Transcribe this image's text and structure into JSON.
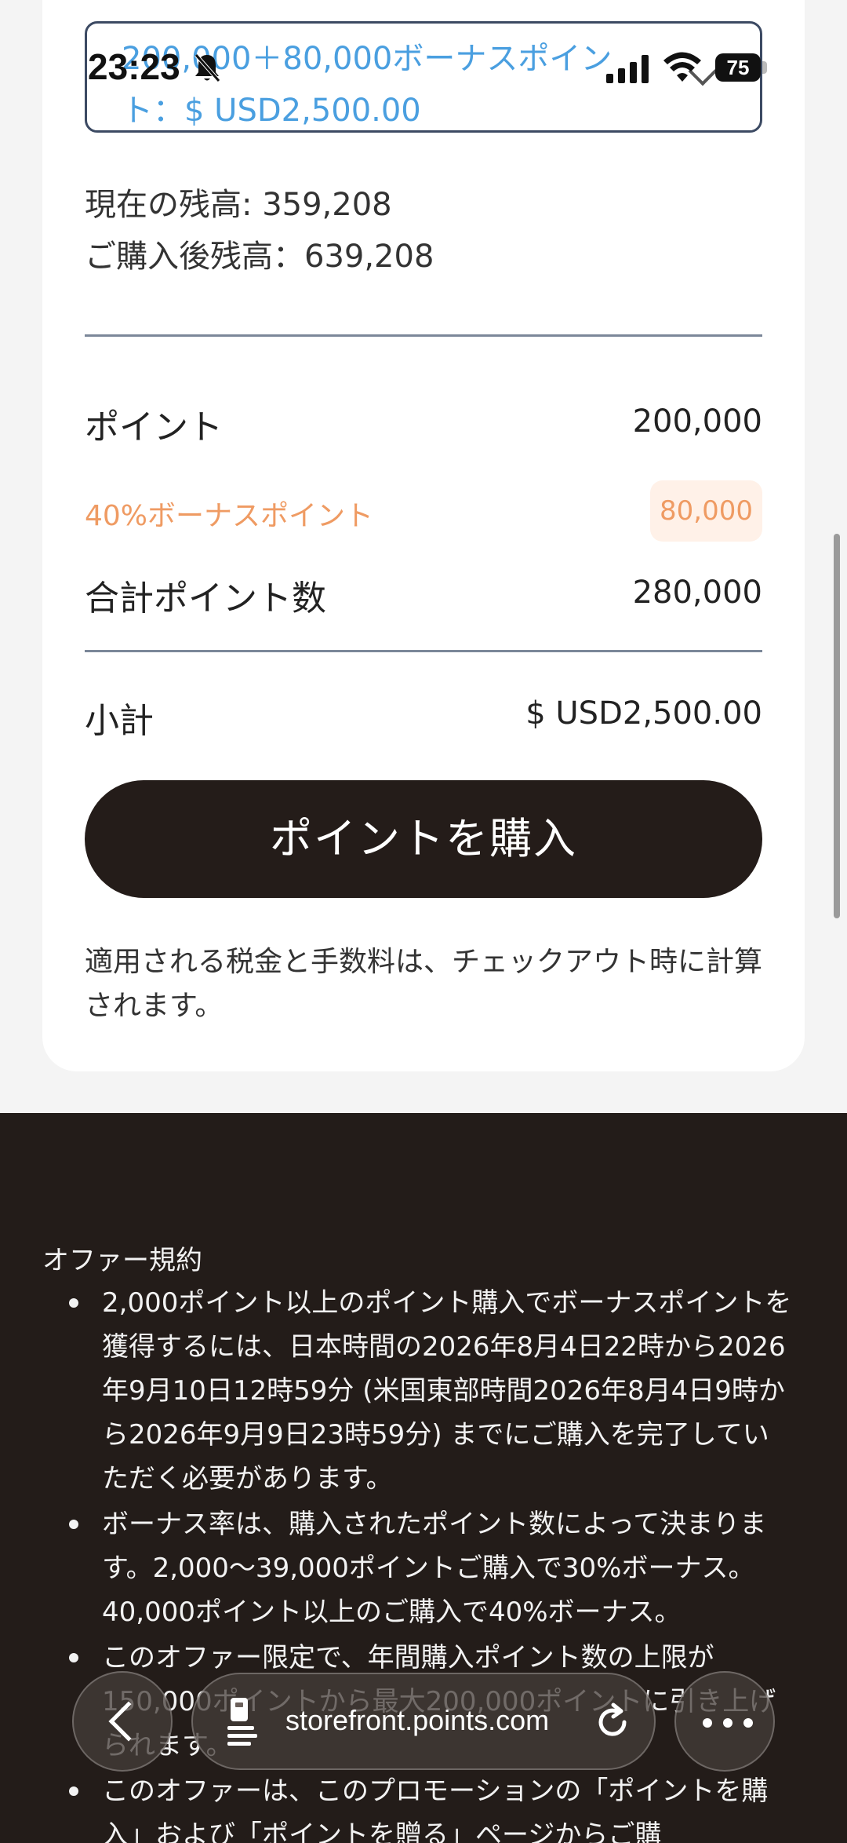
{
  "status": {
    "time": "23:23",
    "battery": "75"
  },
  "package_select": {
    "value_line1": "200,000＋80,000ボーナスポイン",
    "value_line2": "ト：$ USD2,500.00"
  },
  "balance": {
    "current": "現在の残高: 359,208",
    "after": "ご購入後残高：639,208"
  },
  "summary": {
    "points_label": "ポイント",
    "points_value": "200,000",
    "bonus_label": "40%ボーナスポイント",
    "bonus_value": "80,000",
    "total_label": "合計ポイント数",
    "total_value": "280,000",
    "subtotal_label": "小計",
    "subtotal_value": "$ USD2,500.00"
  },
  "buy_button": "ポイントを購入",
  "tax_note": "適用される税金と手数料は、チェックアウト時に計算されます。",
  "terms": {
    "title": "オファー規約",
    "items": [
      "2,000ポイント以上のポイント購入でボーナスポイントを獲得するには、日本時間の2026年8月4日22時から2026年9月10日12時59分 (米国東部時間2026年8月4日9時から2026年9月9日23時59分) までにご購入を完了していただく必要があります。",
      "ボーナス率は、購入されたポイント数によって決まります。2,000〜39,000ポイントご購入で30%ボーナス。40,000ポイント以上のご購入で40%ボーナス。",
      "このオファー限定で、年間購入ポイント数の上限が150,000ポイントから最大200,000ポイントに引き上げられます。",
      "このオファーは、このプロモーションの「ポイントを購入」および「ポイントを贈る」ページからご購"
    ]
  },
  "browser": {
    "url": "storefront.points.com"
  }
}
